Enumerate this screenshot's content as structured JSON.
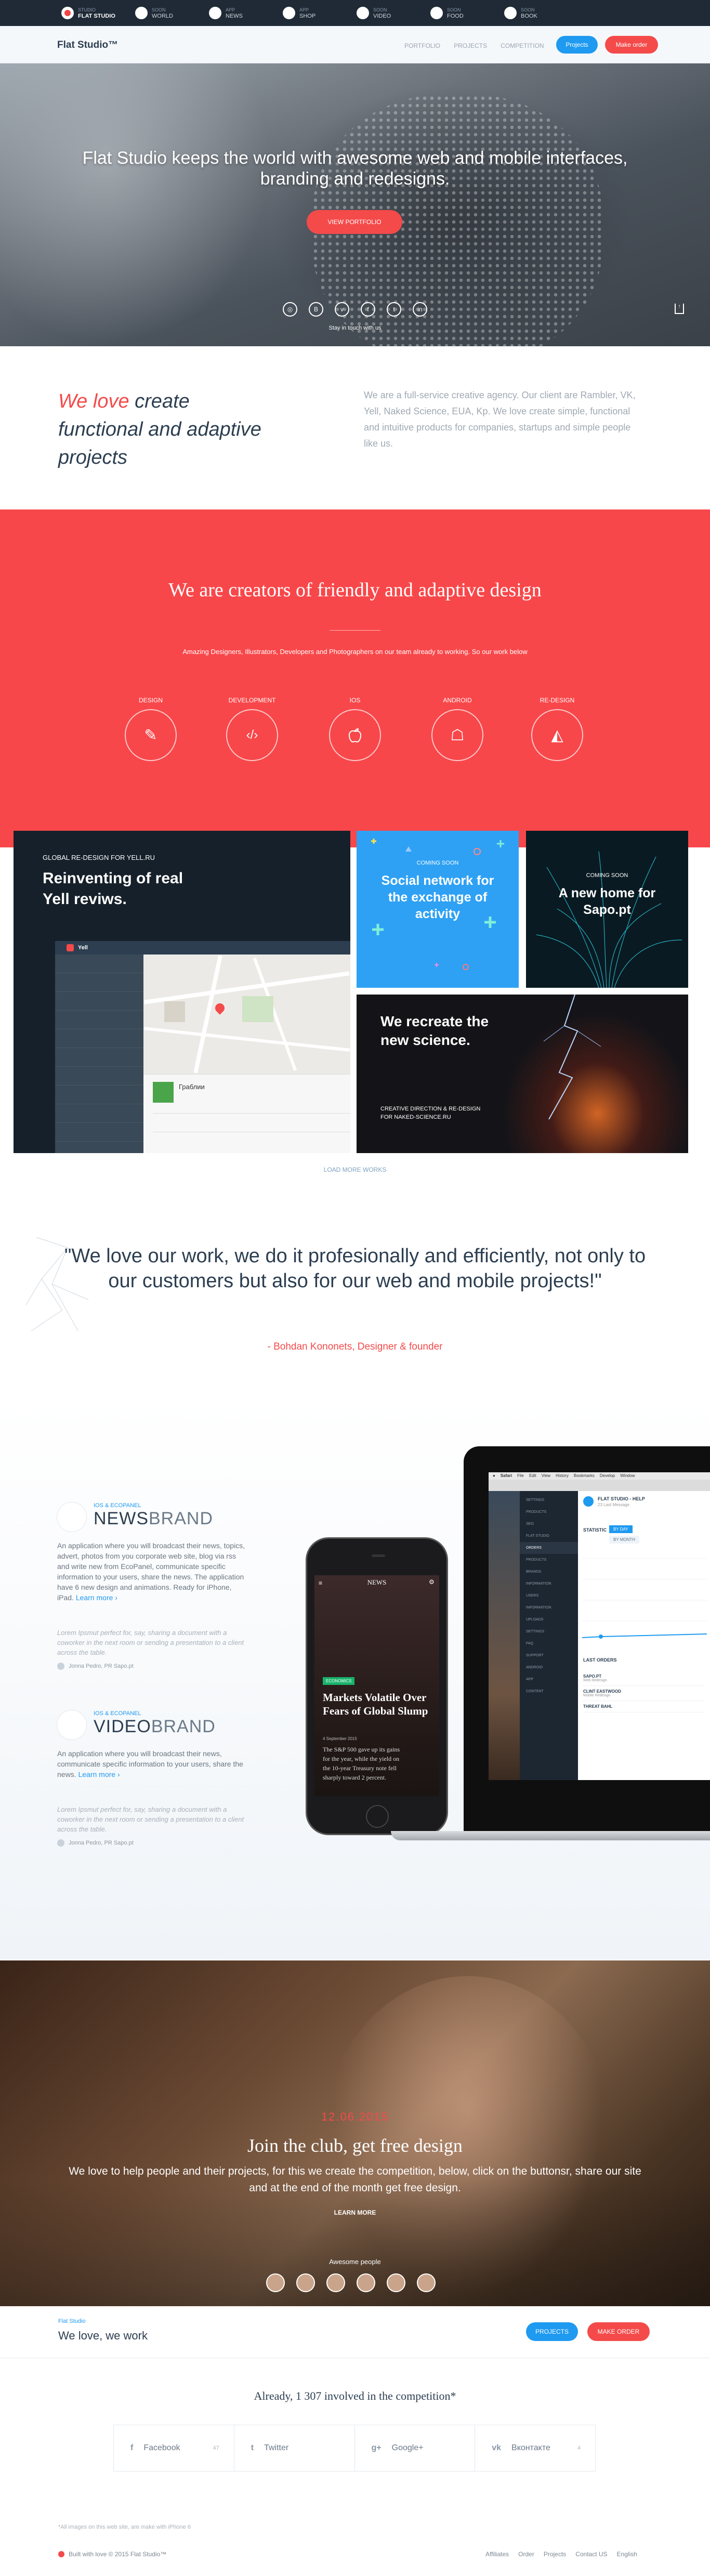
{
  "topstrip": {
    "items": [
      {
        "t1": "STUDIO",
        "t2": "FLAT STUDIO",
        "active": true
      },
      {
        "t1": "SOON",
        "t2": "WORLD"
      },
      {
        "t1": "APP",
        "t2": "NEWS"
      },
      {
        "t1": "APP",
        "t2": "SHOP"
      },
      {
        "t1": "SOON",
        "t2": "VIDEO"
      },
      {
        "t1": "SOON",
        "t2": "FOOD"
      },
      {
        "t1": "SOON",
        "t2": "BOOK"
      }
    ]
  },
  "nav": {
    "logo": "Flat Studio™",
    "links": [
      "PORTFOLIO",
      "PROJECTS",
      "COMPETITION"
    ],
    "projects_btn": "Projects",
    "order_btn": "Make order"
  },
  "hero": {
    "title": "Flat Studio keeps the world with awesome web and mobile interfaces, branding and redesigns.",
    "cta": "VIEW PORTFOLIO",
    "stay": "Stay in touch with us"
  },
  "intro": {
    "title_red": "We love",
    "title_rest": " create functional and adaptive projects",
    "text": "We are a full-service creative agency. Our client are Rambler, VK, Yell, Naked Science, EUA, Kp. We love create simple, functional and intuitive products for companies, startups and simple people like us."
  },
  "creators": {
    "title": "We are creators of friendly and adaptive design",
    "subtitle": "Amazing Designers, Illustrators, Developers and Photographers on our team already to working. So our work below",
    "skills": [
      {
        "label": "DESIGN",
        "icon": "design-icon",
        "glyph": "✎"
      },
      {
        "label": "DEVELOPMENT",
        "icon": "code-icon",
        "glyph": "‹/›"
      },
      {
        "label": "IOS",
        "icon": "apple-icon",
        "glyph": ""
      },
      {
        "label": "ANDROID",
        "icon": "android-icon",
        "glyph": "☖"
      },
      {
        "label": "RE-DESIGN",
        "icon": "shapes-icon",
        "glyph": "◭"
      }
    ]
  },
  "portfolio": {
    "yell_tag": "GLOBAL RE-DESIGN FOR YELL.RU",
    "yell_title_1": "Reinventing of real",
    "yell_title_2": "Yell reviws.",
    "yell_brand": "Yell",
    "yell_place": "Граблии",
    "social_soon": "COMING SOON",
    "social_title": "Social network for the exchange of activity",
    "sapo_soon": "COMING SOON",
    "sapo_title": "A new home for Sapo.pt",
    "sci_title_1": "We recreate the",
    "sci_title_2": "new science.",
    "sci_caption_1": "CREATIVE DIRECTION & RE-DESIGN",
    "sci_caption_2": "FOR NAKED-SCIENCE.RU",
    "load_more": "LOAD MORE WORKS"
  },
  "quote": {
    "text": "\"We love our work, we do it profesionally and efficiently, not only to our customers but also for our web and mobile projects!\"",
    "author": "- Bohdan Kononets, Designer & founder"
  },
  "apps": [
    {
      "small": "IOS & ECOPANEL",
      "big_bold": "NEWS",
      "big_light": "BRAND",
      "desc": "An application where you will broadcast their news, topics, advert, photos from you corporate web site, blog via rss and write new from EcoPanel, communicate specific information to your users, share the news. The application have 6 new design and animations. Ready for iPhone, iPad. ",
      "link": "Learn more ›",
      "review": "Lorem Ipsmut perfect for, say, sharing a document with a coworker in the next room or sending a presentation to a client across the table.",
      "who": "Jonna Pedro, PR Sapo.pt"
    },
    {
      "small": "IOS & ECOPANEL",
      "big_bold": "VIDEO",
      "big_light": "BRAND",
      "desc": "An application where you will broadcast their news, communicate specific information to your users, share the news. ",
      "link": "Learn more ›",
      "review": "Lorem Ipsmut perfect for, say, sharing a document with a coworker in the next room or sending a presentation to a client across the table.",
      "who": "Jonna Pedro, PR Sapo.pt"
    }
  ],
  "phone": {
    "brand": "NEWS",
    "tag": "ECONOMICS",
    "headline": "Markets Volatile Over Fears of Global Slump",
    "date": "4 September 2015",
    "body": "The S&P 500 gave up its gains for the year, while the yield on the 10-year Treasury note fell sharply toward 2 percent."
  },
  "laptop": {
    "menu": [
      "Safari",
      "File",
      "Edit",
      "View",
      "History",
      "Bookmarks",
      "Develop",
      "Window"
    ],
    "app_title": "FLAT STUDIO - HELP",
    "app_sub": "23 Last Message",
    "stat_label": "STATISTIC",
    "stat_period": "BY DAY",
    "stat_month": "BY MONTH",
    "sidebar": [
      "SETTINGS",
      "PRODUCTS",
      "SEO",
      "FLAT STUDIO",
      "ORDERS",
      "PRODUCTS",
      "BRANDS",
      "INFORMATION",
      "USERS",
      "INFORMATION",
      "UPLOADS",
      "SETTINGS",
      "FAQ",
      "SUPPORT",
      "ANDROID",
      "APP",
      "CONTENT"
    ],
    "orders_title": "LAST ORDERS",
    "orders": [
      {
        "name": "SAPO.PT",
        "sub": "Web Redesign"
      },
      {
        "name": "CLINT EASTWOOD",
        "sub": "Mobile Redesign"
      },
      {
        "name": "THREAT BAHL",
        "sub": ""
      }
    ]
  },
  "join": {
    "date": "12.06.2015",
    "title": "Join the club, get free design",
    "text": "We love to help people and their projects, for this we create the competition, below, click on the buttonsr, share our site and at the end of the month get free design.",
    "learn": "LEARN MORE",
    "awesome": "Awesome people"
  },
  "footer_cta": {
    "small": "Flat Studio",
    "big": "We love, we work",
    "projects_btn": "PROJECTS",
    "order_btn": "MAKE ORDER"
  },
  "competition": {
    "count_text": "Already, 1 307 involved in the competition*",
    "shares": [
      {
        "name": "Facebook",
        "icon": "f",
        "count": "47"
      },
      {
        "name": "Twitter",
        "icon": "t",
        "count": ""
      },
      {
        "name": "Google+",
        "icon": "g+",
        "count": ""
      },
      {
        "name": "Вконтакте",
        "icon": "vk",
        "count": "4"
      }
    ]
  },
  "footer": {
    "note": "*All images on this web site, are make with iPhone 6",
    "built": "Built with love © 2015 Flat Studio™",
    "links": [
      "Affiliates",
      "Order",
      "Projects",
      "Contact US",
      "English"
    ]
  }
}
